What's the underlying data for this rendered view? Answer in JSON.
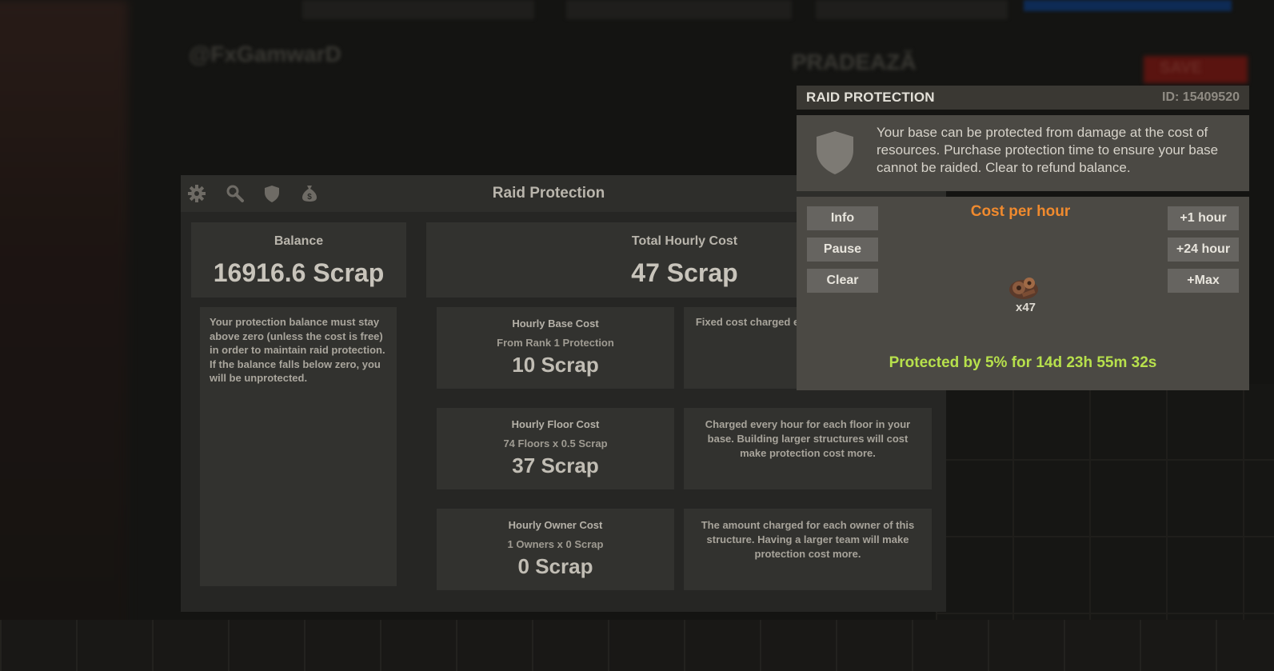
{
  "background": {
    "blurred_name": "@FxGamwarD",
    "blurred_word": "PRADEAZĂ",
    "blurred_button": "SAVE"
  },
  "panel": {
    "title": "Raid Protection",
    "header_icons": [
      "gear-icon",
      "search-icon",
      "shield-icon",
      "money-bag-icon"
    ],
    "balance": {
      "label": "Balance",
      "value": "16916.6 Scrap"
    },
    "total": {
      "label": "Total Hourly Cost",
      "value": "47 Scrap"
    },
    "note": "Your protection balance must stay above zero (unless the cost is free) in order to maintain raid protection. If the balance falls below zero, you will be unprotected.",
    "costs": [
      {
        "title": "Hourly Base Cost",
        "detail": "From Rank 1 Protection",
        "value": "10 Scrap",
        "description": "Fixed cost charged every hour for protection."
      },
      {
        "title": "Hourly Floor Cost",
        "detail": "74 Floors x 0.5 Scrap",
        "value": "37 Scrap",
        "description": "Charged every hour for each floor in your base. Building larger structures will cost make protection cost more."
      },
      {
        "title": "Hourly Owner Cost",
        "detail": "1 Owners x 0 Scrap",
        "value": "0 Scrap",
        "description": "The amount charged for each owner of this structure. Having a larger team will make protection cost more."
      }
    ]
  },
  "raid_panel": {
    "title": "RAID PROTECTION",
    "id": "ID: 15409520",
    "info_text": "Your base can be protected from damage at the cost of resources. Purchase protection time to ensure your base cannot be raided. Clear to refund balance.",
    "left_buttons": [
      "Info",
      "Pause",
      "Clear"
    ],
    "right_buttons": [
      "+1 hour",
      "+24 hour",
      "+Max"
    ],
    "cost_title": "Cost per hour",
    "cost_item_icon": "scrap-icon",
    "cost_quantity": "x47",
    "status": "Protected by 5% for 14d 23h 55m 32s",
    "colors": {
      "cost_title": "#f08a2e",
      "status": "#b7e04c"
    }
  }
}
